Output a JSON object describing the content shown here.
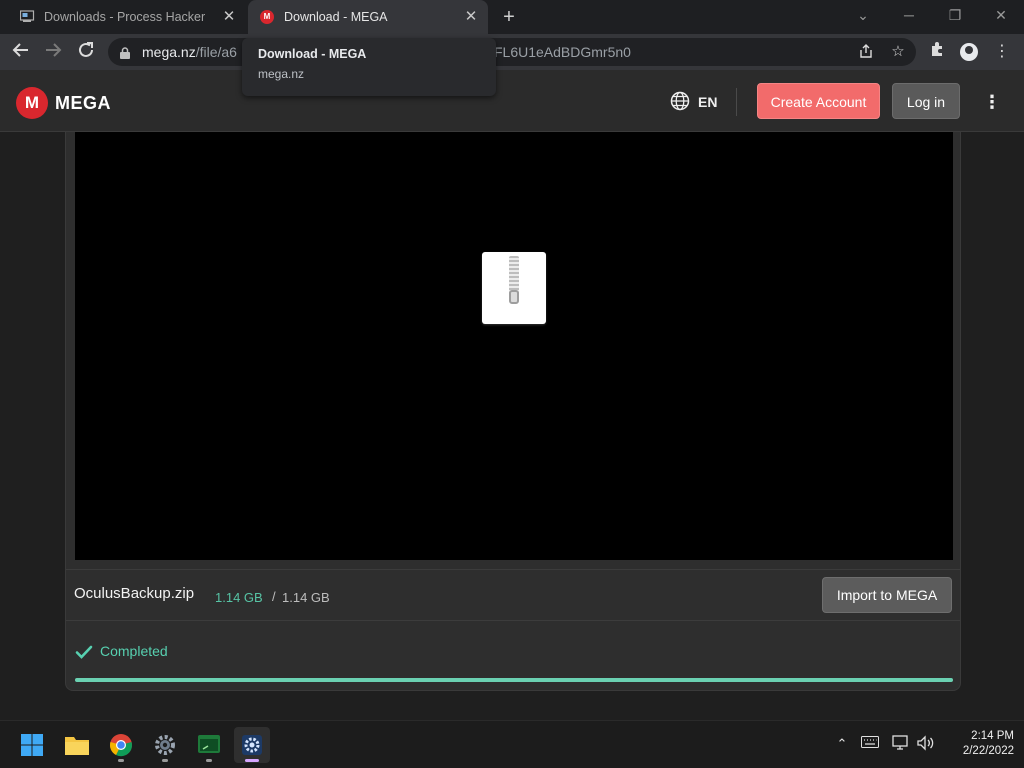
{
  "browser": {
    "tabs": [
      {
        "label": "Downloads - Process Hacker",
        "active": false
      },
      {
        "label": "Download - MEGA",
        "active": true
      }
    ],
    "new_tab_symbol": "+",
    "tooltip": {
      "title": "Download - MEGA",
      "host": "mega.nz"
    },
    "omnibox": {
      "url_host": "mega.nz",
      "url_path_visible": "/file/a6",
      "url_tail_visible": "FL6U1eAdBDGmr5n0"
    },
    "icons": [
      "back-icon",
      "forward-icon",
      "reload-icon",
      "lock-icon",
      "share-icon",
      "star-icon",
      "extensions-icon",
      "profile-icon",
      "menu-icon"
    ]
  },
  "mega_header": {
    "logo_letter": "M",
    "logo_text": "MEGA",
    "language": "EN",
    "create_account_label": "Create Account",
    "login_label": "Log in",
    "brand_color": "#d9272e",
    "create_account_color": "#f26b6b"
  },
  "file": {
    "name": "OculusBackup.zip",
    "downloaded": "1.14 GB",
    "separator": "/",
    "total": "1.14 GB",
    "import_label": "Import to MEGA"
  },
  "status": {
    "label": "Completed",
    "progress": 1.0,
    "color": "#57d0b0"
  },
  "taskbar": {
    "apps": [
      "windows-start-icon",
      "file-explorer-icon",
      "chrome-icon",
      "settings-gear-icon",
      "terminal-icon",
      "process-hacker-icon"
    ],
    "clock": {
      "time": "2:14 PM",
      "date": "2/22/2022"
    }
  }
}
